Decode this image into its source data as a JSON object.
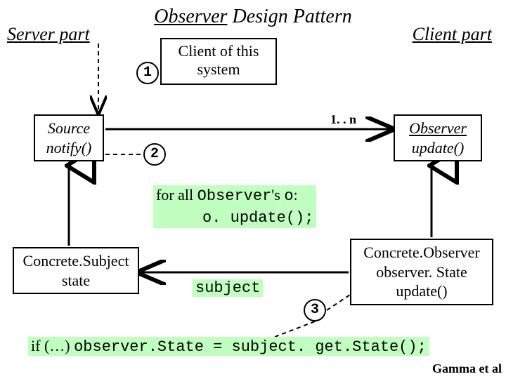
{
  "title_prefix": "Observer",
  "title_suffix": " Design Pattern",
  "server_part": "Server part",
  "client_part": "Client part",
  "client_of_this_l1": "Client of this",
  "client_of_this_l2": "system",
  "num1": "1",
  "num2": "2",
  "num3": "3",
  "source_l1": "Source",
  "source_l2": "notify()",
  "observer_l1": "Observer",
  "observer_l2": "update()",
  "multiplicity": "1. . n",
  "forall_l1_a": "for all ",
  "forall_l1_b": "Observer",
  "forall_l1_c": "'s ",
  "forall_l1_d": "o",
  "forall_l1_e": ":",
  "forall_l2": "     o. update();",
  "concrete_subject_l1": "Concrete.Subject",
  "concrete_subject_l2": "state",
  "concrete_observer_l1": "Concrete.Observer",
  "concrete_observer_l2": "observer. State",
  "concrete_observer_l3": "update()",
  "subject_label": "subject",
  "ifline_a": "if (…) ",
  "ifline_b": "observer.State = subject. get.State();",
  "credit": "Gamma et al"
}
